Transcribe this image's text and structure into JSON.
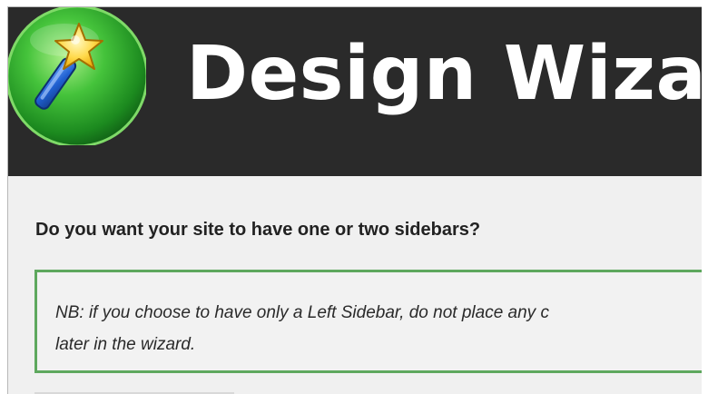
{
  "header": {
    "title": "Design Wizard",
    "logo_icon": "magic-wand-star-icon",
    "background_color": "#2a2a2a"
  },
  "content": {
    "question": "Do you want your site to have one or two sidebars?",
    "note_line_1": "NB: if you choose to have only a Left Sidebar, do not place any c",
    "note_line_2": "later in the wizard.",
    "note_border_color": "#5ea85e"
  }
}
